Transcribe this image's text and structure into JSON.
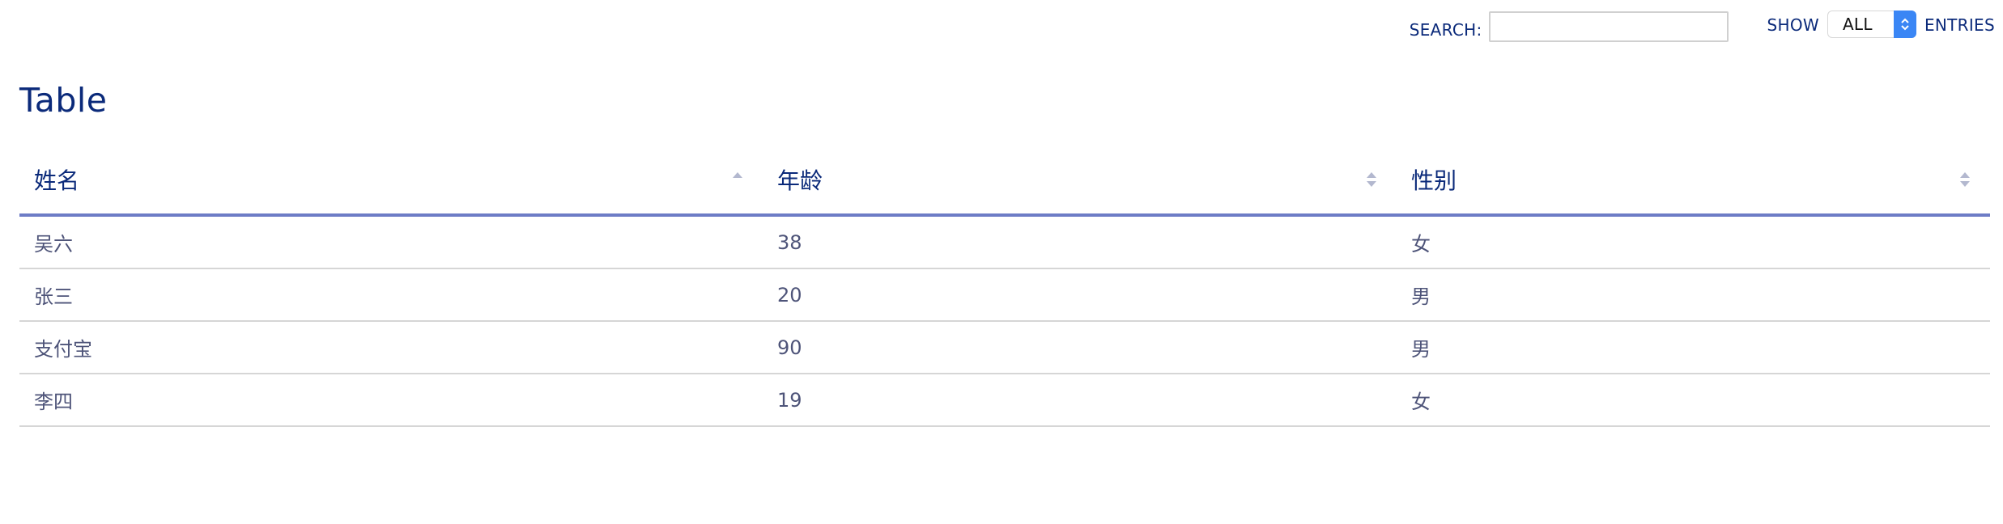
{
  "search": {
    "label": "SEARCH:",
    "value": "",
    "placeholder": ""
  },
  "length": {
    "show_label": "SHOW",
    "selected": "ALL",
    "entries_label": "ENTRIES"
  },
  "title": "Table",
  "table": {
    "columns": [
      {
        "label": "姓名",
        "sort": "ascending"
      },
      {
        "label": "年龄",
        "sort": "none"
      },
      {
        "label": "性别",
        "sort": "none"
      }
    ],
    "rows": [
      [
        "吴六",
        "38",
        "女"
      ],
      [
        "张三",
        "20",
        "男"
      ],
      [
        "支付宝",
        "90",
        "男"
      ],
      [
        "李四",
        "19",
        "女"
      ]
    ]
  },
  "colors": {
    "text_primary": "#0b2a7a",
    "header_rule": "#6d7cc6",
    "cell_text": "#4e5479",
    "row_divider": "#d6d6d6",
    "select_accent": "#3a86f5"
  },
  "icons": {
    "sort_ascending": "sort-ascending-icon",
    "sort_both": "sort-both-icon",
    "select_arrows": "select-arrows-icon"
  }
}
